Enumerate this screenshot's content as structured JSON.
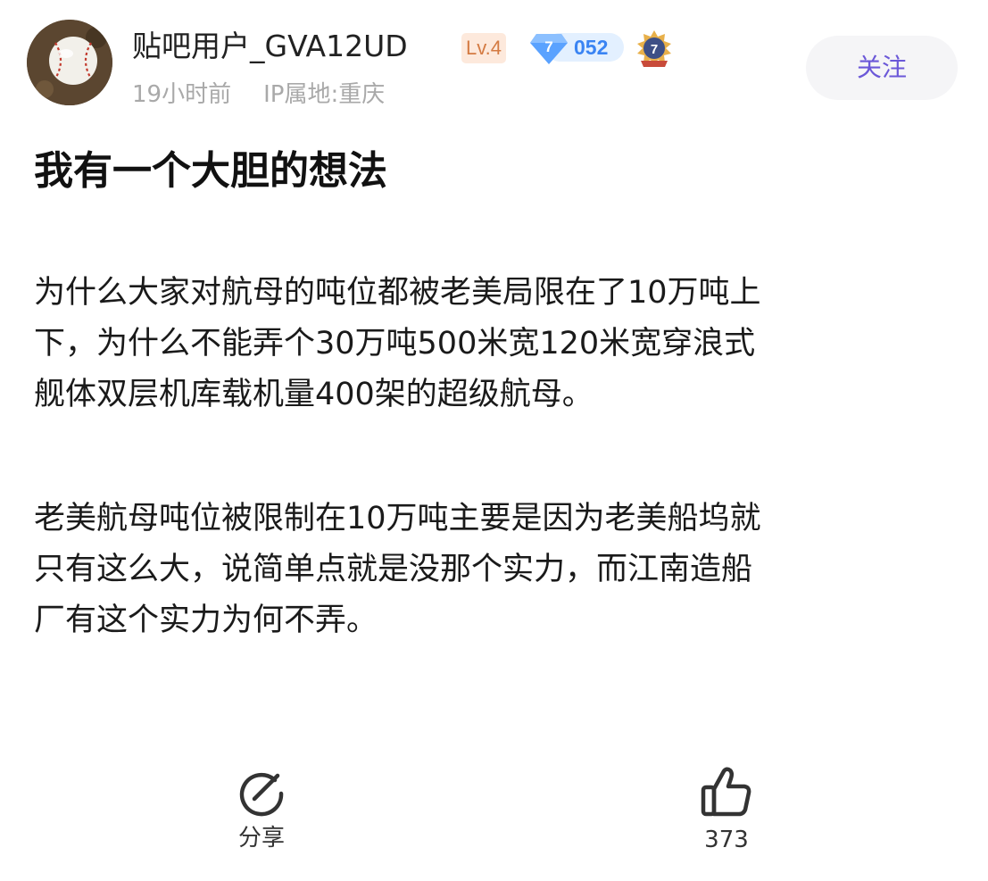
{
  "author": {
    "avatar_icon": "baseball-avatar",
    "name": "贴吧用户_GVA12UD",
    "level": "Lv.4",
    "gem_level": "7",
    "gem_count": "052",
    "medal_number": "7",
    "time": "19小时前",
    "ip_location": "IP属地:重庆",
    "follow_label": "关注"
  },
  "post": {
    "title": "我有一个大胆的想法",
    "paragraph1": [
      "为什么大家对航母的吨位都被老美局限在了10万吨上",
      "下，为什么不能弄个30万吨500米宽120米宽穿浪式",
      "舰体双层机库载机量400架的超级航母。"
    ],
    "paragraph2": [
      "老美航母吨位被限制在10万吨主要是因为老美船坞就",
      "只有这么大，说简单点就是没那个实力，而江南造船",
      "厂有这个实力为何不弄。"
    ]
  },
  "actions": {
    "share_label": "分享",
    "share_icon": "share-icon",
    "like_count": "373",
    "like_icon": "thumbs-up-icon"
  },
  "colors": {
    "accent": "#6b58d8",
    "gem": "#3a84f3",
    "level_text": "#d47b43",
    "meta_text": "#a9a9a9"
  }
}
